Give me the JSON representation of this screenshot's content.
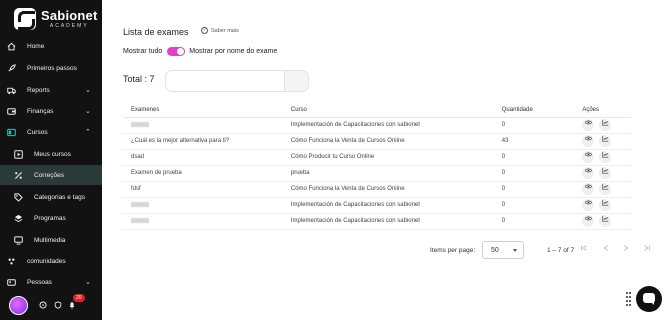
{
  "brand": {
    "name": "Sabionet",
    "subtitle": "ACADEMY"
  },
  "sidebar": {
    "items": [
      {
        "label": "Home",
        "icon": "home-icon"
      },
      {
        "label": "Primeiros passos",
        "icon": "rocket-icon"
      },
      {
        "label": "Reports",
        "icon": "truck-icon",
        "chevron": "⌄"
      },
      {
        "label": "Finanças",
        "icon": "wallet-icon",
        "chevron": "⌄"
      },
      {
        "label": "Cursos",
        "icon": "course-icon",
        "chevron": "⌃"
      },
      {
        "label": "Meus cursos",
        "icon": "play-icon"
      },
      {
        "label": "Correções",
        "icon": "percent-icon"
      },
      {
        "label": "Categorias e tags",
        "icon": "tag-icon"
      },
      {
        "label": "Programas",
        "icon": "layers-icon"
      },
      {
        "label": "Multimedia",
        "icon": "monitor-icon"
      },
      {
        "label": "comunidades",
        "icon": "community-icon"
      },
      {
        "label": "Pessoas",
        "icon": "people-icon",
        "chevron": "⌄"
      }
    ],
    "active_item": "Correções",
    "notification_count": "20"
  },
  "page": {
    "title": "Lista de exames",
    "help_label": "Saber mais",
    "toggle": {
      "left_label": "Mostrar tudo",
      "right_label": "Mostrar por nome do exame",
      "on": true
    },
    "total_label": "Total : 7",
    "search": {
      "value": "",
      "placeholder": ""
    }
  },
  "table": {
    "headers": [
      "Examenes",
      "Curso",
      "Quantidade",
      "Ações"
    ],
    "rows": [
      {
        "exam": "",
        "exam_redacted": true,
        "course": "Implementación de Capacitaciones con sabionet",
        "qty": "0"
      },
      {
        "exam": "¿Cuál es la mejor alternativa para ti?",
        "exam_redacted": false,
        "course": "Cómo Funciona la Venta de Cursos Online",
        "qty": "43"
      },
      {
        "exam": "dsad",
        "exam_redacted": false,
        "course": "Cómo Producir tu Curso Online",
        "qty": "0"
      },
      {
        "exam": "Examen de prueba",
        "exam_redacted": false,
        "course": "prueba",
        "qty": "0"
      },
      {
        "exam": "fdsf",
        "exam_redacted": false,
        "course": "Cómo Funciona la Venta de Cursos Online",
        "qty": "0"
      },
      {
        "exam": "",
        "exam_redacted": true,
        "course": "Implementación de Capacitaciones con sabionet",
        "qty": "0"
      },
      {
        "exam": "",
        "exam_redacted": true,
        "course": "Implementación de Capacitaciones con sabionet",
        "qty": "0"
      }
    ],
    "action_icons": [
      "eye-icon",
      "chart-icon"
    ]
  },
  "pagination": {
    "items_per_page_label": "Items per page:",
    "items_per_page_value": "50",
    "range_label": "1 – 7 of 7"
  },
  "colors": {
    "sidebar_bg": "#121212",
    "active_bg": "#2a3a38",
    "accent": "#e040c8"
  }
}
